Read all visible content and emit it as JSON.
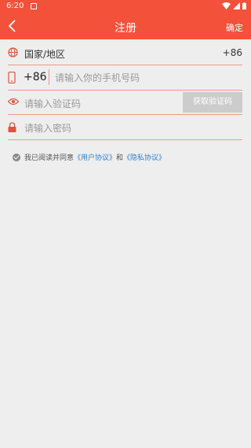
{
  "status": {
    "time": "6:20"
  },
  "header": {
    "title": "注册",
    "confirm_label": "确定"
  },
  "form": {
    "country_label": "国家/地区",
    "country_code": "+86",
    "phone_prefix": "+86",
    "phone_placeholder": "请输入你的手机号码",
    "code_placeholder": "请输入验证码",
    "get_code_label": "获取验证码",
    "password_placeholder": "请输入密码"
  },
  "agreement": {
    "text": "我已阅读并同意",
    "user_agreement": "《用户协议》",
    "and": "和",
    "privacy_agreement": "《隐私协议》"
  },
  "colors": {
    "accent": "#f4513a",
    "link": "#2a7fd4",
    "divider": "#e9998e"
  }
}
